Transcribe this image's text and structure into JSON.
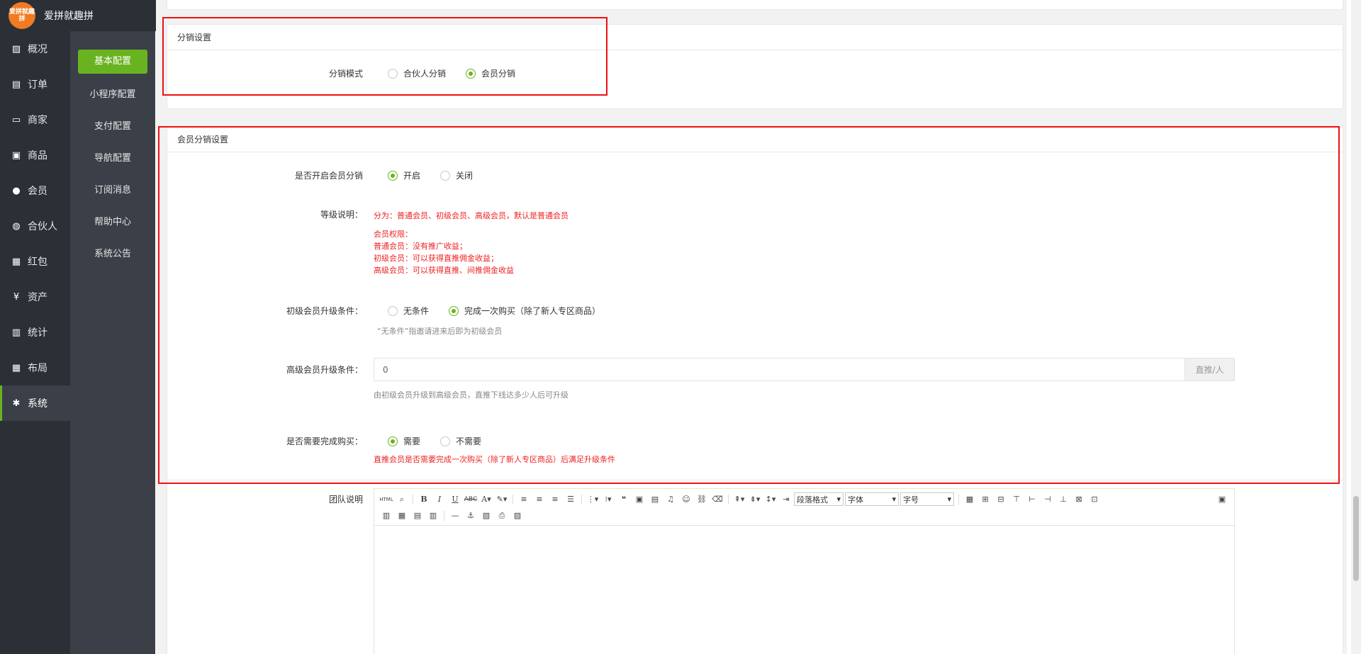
{
  "brand": {
    "logo_text": "爱拼就趣拼",
    "name": "爱拼就趣拼"
  },
  "nav": [
    {
      "label": "概况",
      "icon": "chart-icon",
      "glyph": "▨"
    },
    {
      "label": "订单",
      "icon": "order-icon",
      "glyph": "▤"
    },
    {
      "label": "商家",
      "icon": "store-icon",
      "glyph": "▭"
    },
    {
      "label": "商品",
      "icon": "goods-icon",
      "glyph": "▣"
    },
    {
      "label": "会员",
      "icon": "user-icon",
      "glyph": "●"
    },
    {
      "label": "合伙人",
      "icon": "partner-icon",
      "glyph": "◍"
    },
    {
      "label": "红包",
      "icon": "redpacket-icon",
      "glyph": "▦"
    },
    {
      "label": "资产",
      "icon": "yen-icon",
      "glyph": "¥"
    },
    {
      "label": "统计",
      "icon": "stats-icon",
      "glyph": "▥"
    },
    {
      "label": "布局",
      "icon": "layout-icon",
      "glyph": "▦"
    },
    {
      "label": "系统",
      "icon": "gear-icon",
      "glyph": "✱"
    }
  ],
  "subnav": [
    "基本配置",
    "小程序配置",
    "支付配置",
    "导航配置",
    "订阅消息",
    "帮助中心",
    "系统公告"
  ],
  "distribution": {
    "title": "分销设置",
    "mode_label": "分销模式",
    "options": [
      "合伙人分销",
      "会员分销"
    ],
    "selected": 1
  },
  "member": {
    "title": "会员分销设置",
    "enable_label": "是否开启会员分销",
    "enable_options": [
      "开启",
      "关闭"
    ],
    "level_label": "等级说明：",
    "level_line1": "分为：普通会员、初级会员、高级会员，默认是普通会员",
    "level_lines": [
      "会员权限：",
      "普通会员：没有推广收益；",
      "初级会员：可以获得直推佣金收益；",
      "高级会员：可以获得直推、间推佣金收益"
    ],
    "junior_label": "初级会员升级条件：",
    "junior_options": [
      "无条件",
      "完成一次购买（除了新人专区商品）"
    ],
    "junior_hint": "“无条件”指邀请进来后即为初级会员",
    "senior_label": "高级会员升级条件：",
    "senior_value": "0",
    "senior_addon": "直推/人",
    "senior_hint": "由初级会员升级到高级会员，直推下线达多少人后可升级",
    "purchase_label": "是否需要完成购买：",
    "purchase_options": [
      "需要",
      "不需要"
    ],
    "purchase_note": "直推会员是否需要完成一次购买（除了新人专区商品）后满足升级条件"
  },
  "team": {
    "label": "团队说明",
    "sel_para": "段落格式",
    "sel_font": "字体",
    "sel_size": "字号"
  },
  "colors": {
    "accent": "#6ab320",
    "highlight": "#f01010",
    "sidebar": "#2b2f36"
  }
}
